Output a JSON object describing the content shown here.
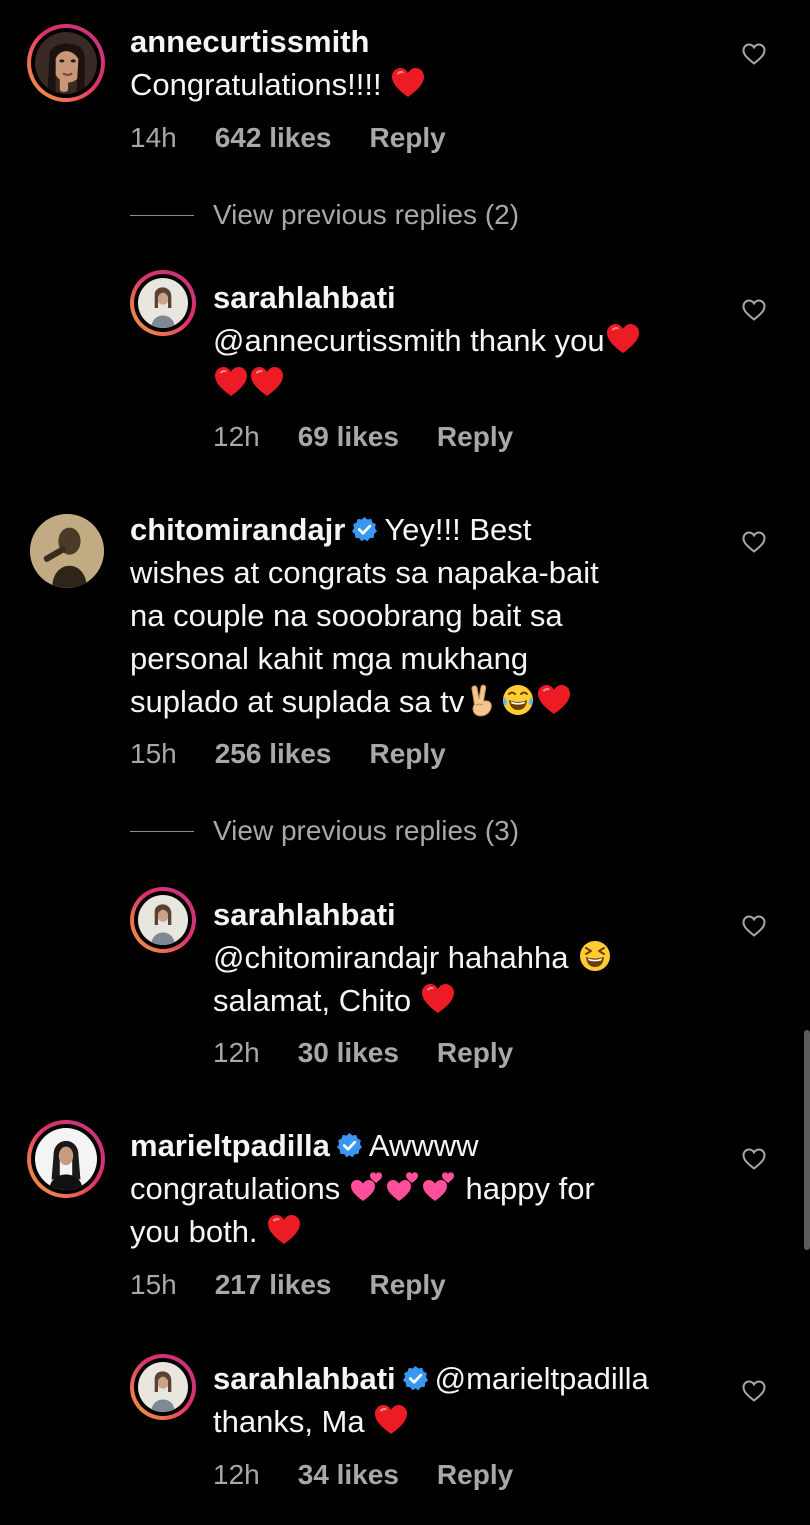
{
  "comments": [
    {
      "username": "annecurtissmith",
      "text": "Congratulations!!!!",
      "time": "14h",
      "likes": "642 likes",
      "reply": "Reply"
    },
    {
      "view_replies": "View previous replies (2)"
    },
    {
      "username": "sarahlahbati",
      "text": "@annecurtissmith thank you",
      "time": "12h",
      "likes": "69 likes",
      "reply": "Reply"
    },
    {
      "username": "chitomirandajr",
      "text_line1": "Yey!!! Best",
      "text_line2": "wishes at congrats sa napaka-bait",
      "text_line3": "na couple na sooobrang bait sa",
      "text_line4": "personal kahit mga mukhang",
      "text_line5": "suplado at suplada sa tv",
      "time": "15h",
      "likes": "256 likes",
      "reply": "Reply"
    },
    {
      "view_replies": "View previous replies (3)"
    },
    {
      "username": "sarahlahbati",
      "text_line1": "@chitomirandajr hahahha",
      "text_line2": "salamat, Chito",
      "time": "12h",
      "likes": "30 likes",
      "reply": "Reply"
    },
    {
      "username": "marieltpadilla",
      "text_line1": "Awwww",
      "text_line2a": "congratulations",
      "text_line2b": "happy for",
      "text_line3": "you both.",
      "time": "15h",
      "likes": "217 likes",
      "reply": "Reply"
    },
    {
      "username": "sarahlahbati",
      "text_line1": "@marieltpadilla",
      "text_line2": "thanks, Ma",
      "time": "12h",
      "likes": "34 likes",
      "reply": "Reply"
    }
  ],
  "icons": {
    "like": "heart-outline-icon",
    "verified": "verified-badge-icon",
    "emoji_heart": "red-heart-emoji",
    "emoji_peace": "victory-hand-emoji",
    "emoji_laugh": "tears-of-joy-emoji",
    "emoji_squint": "grinning-squinting-emoji",
    "emoji_two_hearts": "two-hearts-emoji"
  },
  "colors": {
    "background": "#000000",
    "text": "#f5f5f5",
    "meta": "#a8a8a8",
    "verified": "#3897f0",
    "heart": "#ed1c24",
    "two_hearts": "#ff5fb0"
  }
}
